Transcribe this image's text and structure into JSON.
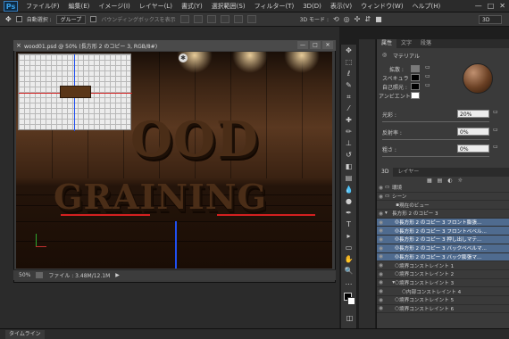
{
  "app": {
    "logo": "Ps"
  },
  "menu": [
    "ファイル(F)",
    "編集(E)",
    "イメージ(I)",
    "レイヤー(L)",
    "書式(Y)",
    "選択範囲(S)",
    "フィルター(T)",
    "3D(D)",
    "表示(V)",
    "ウィンドウ(W)",
    "ヘルプ(H)"
  ],
  "window_controls": {
    "minimize": "—",
    "maximize": "□",
    "close": "✕"
  },
  "options": {
    "auto_select_label": "自動選択 :",
    "auto_select_value": "グループ",
    "bbox_label": "バウンディングボックスを表示",
    "mode_3d_label": "3D モード :",
    "workspace": "3D"
  },
  "document": {
    "tab_title": "wood01.psd @ 50% (長方形 2 のコピー 3, RGB/8#)",
    "zoom": "50%",
    "file_info": "ファイル : 3.48M/12.1M",
    "canvas_text_1": "OOD",
    "canvas_text_2": "GRAINING"
  },
  "properties": {
    "tabs": [
      "属性",
      "文字",
      "段落"
    ],
    "header": "マテリアル",
    "diffuse_label": "拡散 :",
    "specular_label": "スペキュラ :",
    "illumination_label": "自己照光 :",
    "ambient_label": "アンビエント :",
    "shine_label": "光彩 :",
    "shine_value": "20%",
    "reflect_label": "反射率 :",
    "reflect_value": "0%",
    "rough_label": "粗さ :",
    "rough_value": "0%",
    "colors": {
      "diffuse": "#7a7a7a",
      "specular": "#000000",
      "illumination": "#000000",
      "ambient": "#ffffff"
    }
  },
  "layers_panel": {
    "tabs": [
      "3D",
      "レイヤー"
    ],
    "items": [
      {
        "label": "環境",
        "selected": false,
        "indent": 1
      },
      {
        "label": "シーン",
        "selected": false,
        "indent": 1
      },
      {
        "label": "現在のビュー",
        "selected": false,
        "indent": 2
      },
      {
        "label": "長方形 2 のコピー 3",
        "selected": false,
        "indent": 1
      },
      {
        "label": "長方形 2 のコピー 3 フロント膨張...",
        "selected": true,
        "indent": 2
      },
      {
        "label": "長方形 2 のコピー 3 フロントベベル...",
        "selected": true,
        "indent": 2
      },
      {
        "label": "長方形 2 のコピー 3 押し出しマテ...",
        "selected": true,
        "indent": 2
      },
      {
        "label": "長方形 2 のコピー 3 バックベベルマ...",
        "selected": true,
        "indent": 2
      },
      {
        "label": "長方形 2 のコピー 3 バック膨張マ...",
        "selected": true,
        "indent": 2
      },
      {
        "label": "境界コンストレイント 1",
        "selected": false,
        "indent": 2
      },
      {
        "label": "境界コンストレイント 2",
        "selected": false,
        "indent": 2
      },
      {
        "label": "境界コンストレイント 3",
        "selected": false,
        "indent": 2
      },
      {
        "label": "内部コンストレイント 4",
        "selected": false,
        "indent": 3
      },
      {
        "label": "境界コンストレイント 5",
        "selected": false,
        "indent": 2
      },
      {
        "label": "境界コンストレイント 6",
        "selected": false,
        "indent": 2
      }
    ]
  },
  "statusbar": {
    "timeline": "タイムライン"
  }
}
